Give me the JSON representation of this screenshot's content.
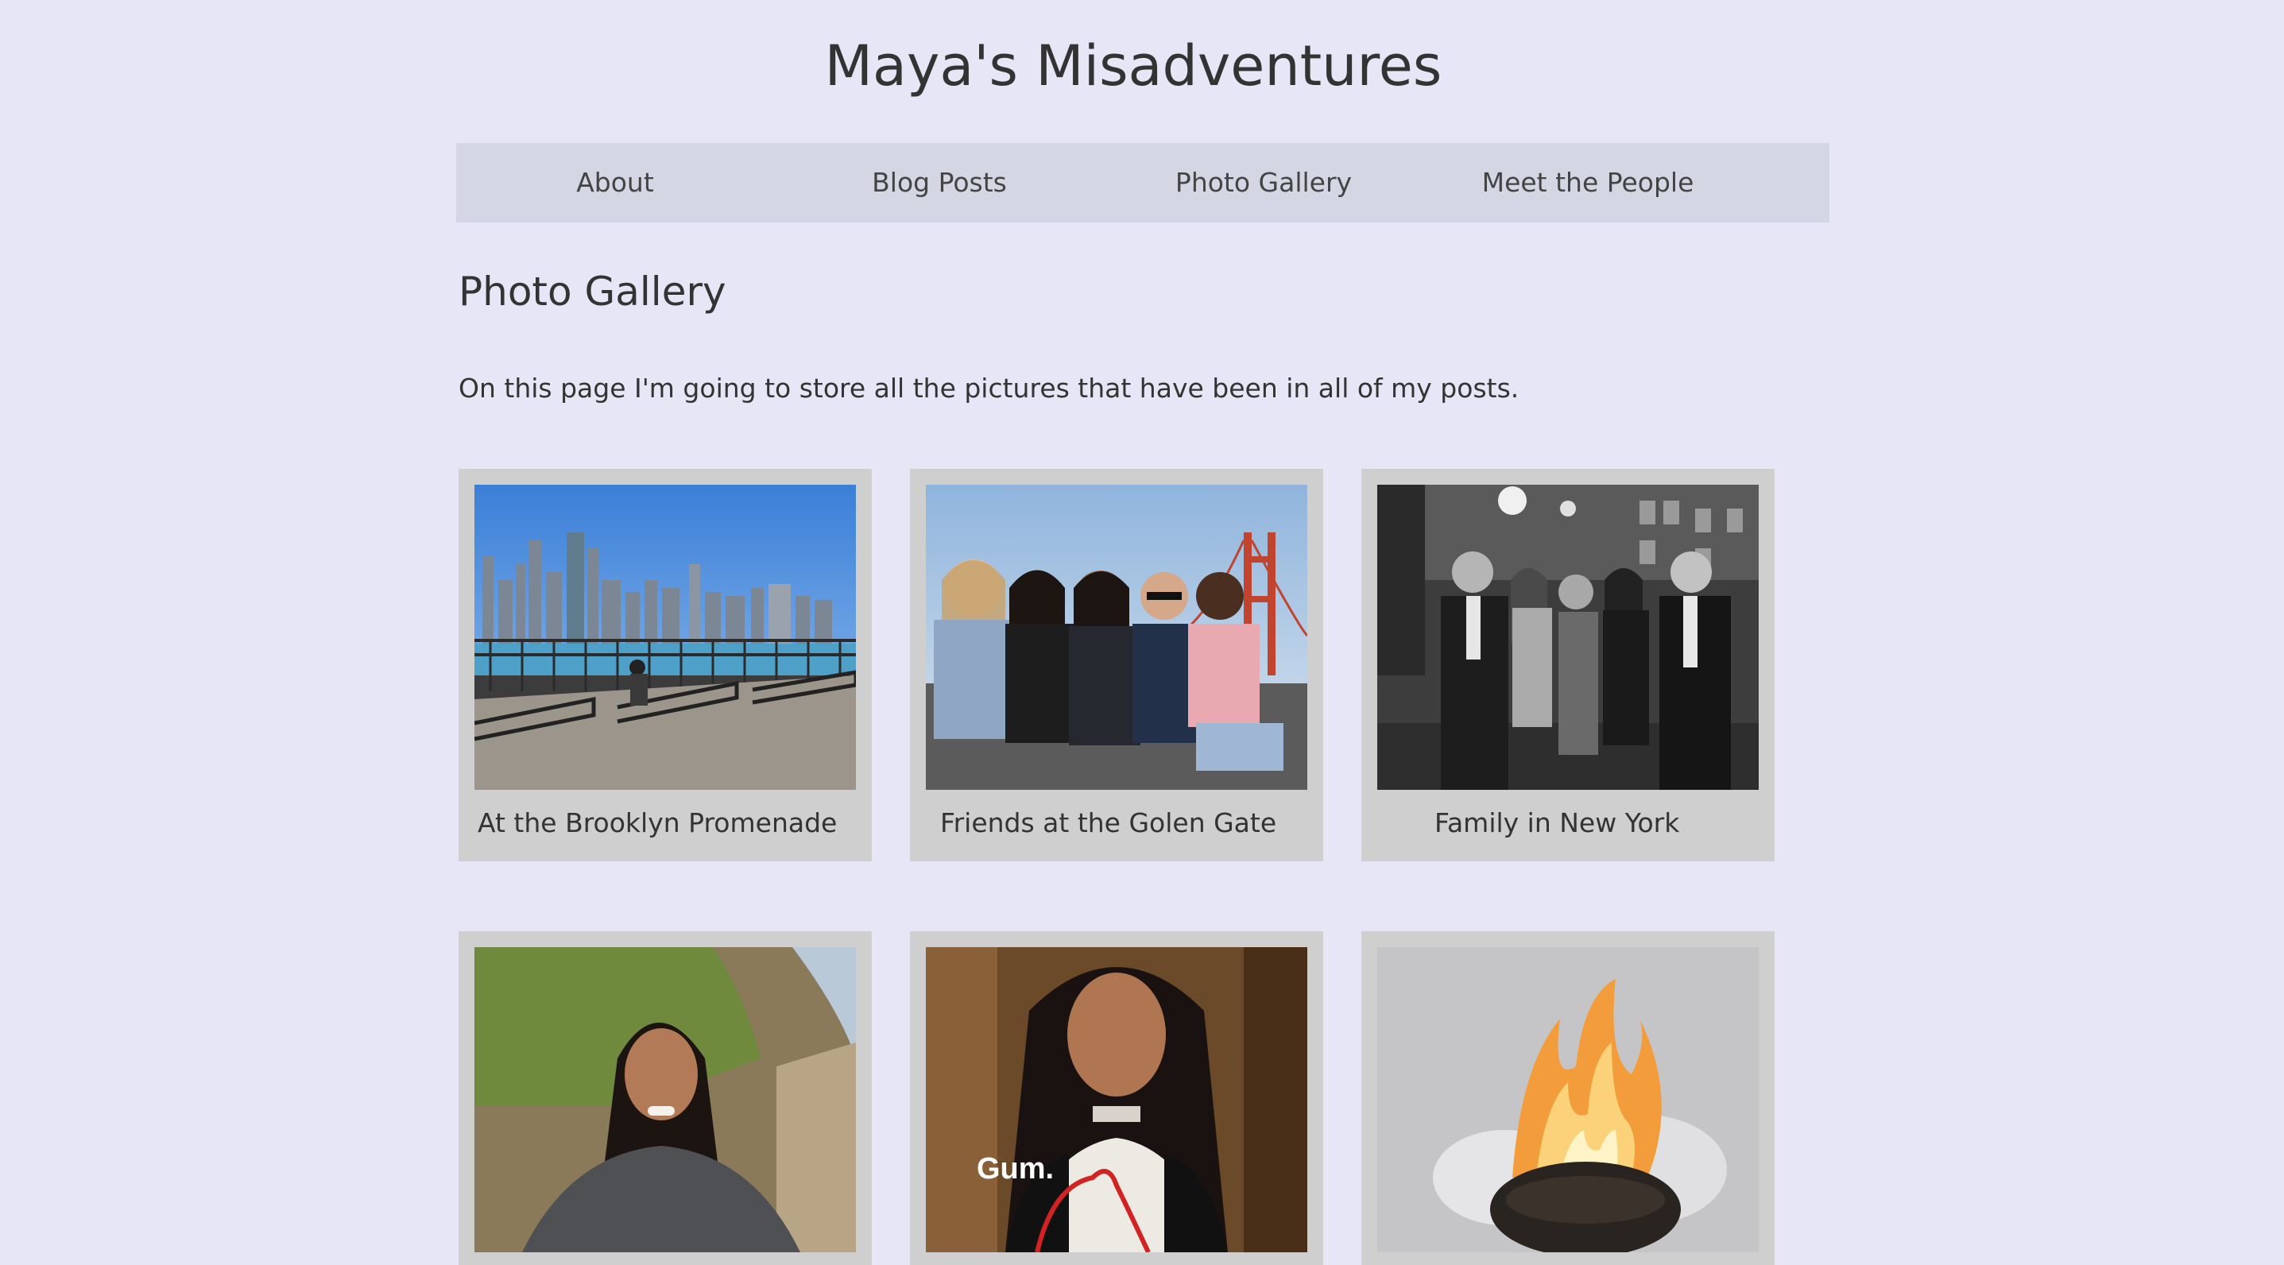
{
  "site": {
    "title": "Maya's Misadventures"
  },
  "nav": {
    "items": [
      "About",
      "Blog Posts",
      "Photo Gallery",
      "Meet the People"
    ]
  },
  "page": {
    "heading": "Photo Gallery",
    "intro": "On this page I'm going to store all the pictures that have been in all of my posts."
  },
  "gallery": {
    "cards": [
      {
        "caption": "At the Brooklyn Promenade"
      },
      {
        "caption": "Friends at the Golen Gate"
      },
      {
        "caption": "Family in New York"
      },
      {
        "caption": ""
      },
      {
        "caption": "",
        "overlay_text": "Gum."
      },
      {
        "caption": ""
      }
    ]
  },
  "colors": {
    "background": "#e6e6f7",
    "nav_background": "#d4d6e4",
    "card_background": "#cfcfcf",
    "text": "#333333"
  }
}
